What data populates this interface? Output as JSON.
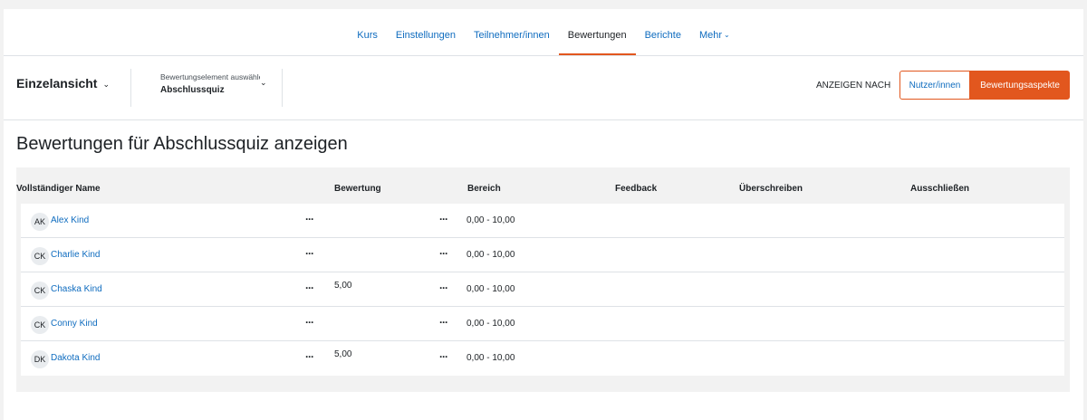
{
  "nav": {
    "items": [
      {
        "label": "Kurs",
        "active": false
      },
      {
        "label": "Einstellungen",
        "active": false
      },
      {
        "label": "Teilnehmer/innen",
        "active": false
      },
      {
        "label": "Bewertungen",
        "active": true
      },
      {
        "label": "Berichte",
        "active": false
      },
      {
        "label": "Mehr",
        "active": false
      }
    ]
  },
  "toolbar": {
    "view_selector": "Einzelansicht",
    "item_selector_label": "Bewertungselement auswählen",
    "item_selector_value": "Abschlussquiz",
    "view_by_label": "ANZEIGEN NACH",
    "users_button": "Nutzer/innen",
    "grade_items_button": "Bewertungsaspekte"
  },
  "page_title": "Bewertungen für Abschlussquiz anzeigen",
  "table": {
    "headers": [
      "Vollständiger Name",
      "Bewertung",
      "Bereich",
      "Feedback",
      "Überschreiben",
      "Ausschließen"
    ],
    "rows": [
      {
        "initials": "AK",
        "name": "Alex Kind",
        "menu": "···",
        "grade": "",
        "menu2": "···",
        "range": "0,00 - 10,00"
      },
      {
        "initials": "CK",
        "name": "Charlie Kind",
        "menu": "···",
        "grade": "",
        "menu2": "···",
        "range": "0,00 - 10,00"
      },
      {
        "initials": "CK",
        "name": "Chaska Kind",
        "menu": "···",
        "grade": "5,00",
        "menu2": "···",
        "range": "0,00 - 10,00"
      },
      {
        "initials": "CK",
        "name": "Conny Kind",
        "menu": "···",
        "grade": "",
        "menu2": "···",
        "range": "0,00 - 10,00"
      },
      {
        "initials": "DK",
        "name": "Dakota Kind",
        "menu": "···",
        "grade": "5,00",
        "menu2": "···",
        "range": "0,00 - 10,00"
      }
    ]
  },
  "colors": {
    "accent": "#e2571e",
    "link": "#0f6cbf"
  }
}
